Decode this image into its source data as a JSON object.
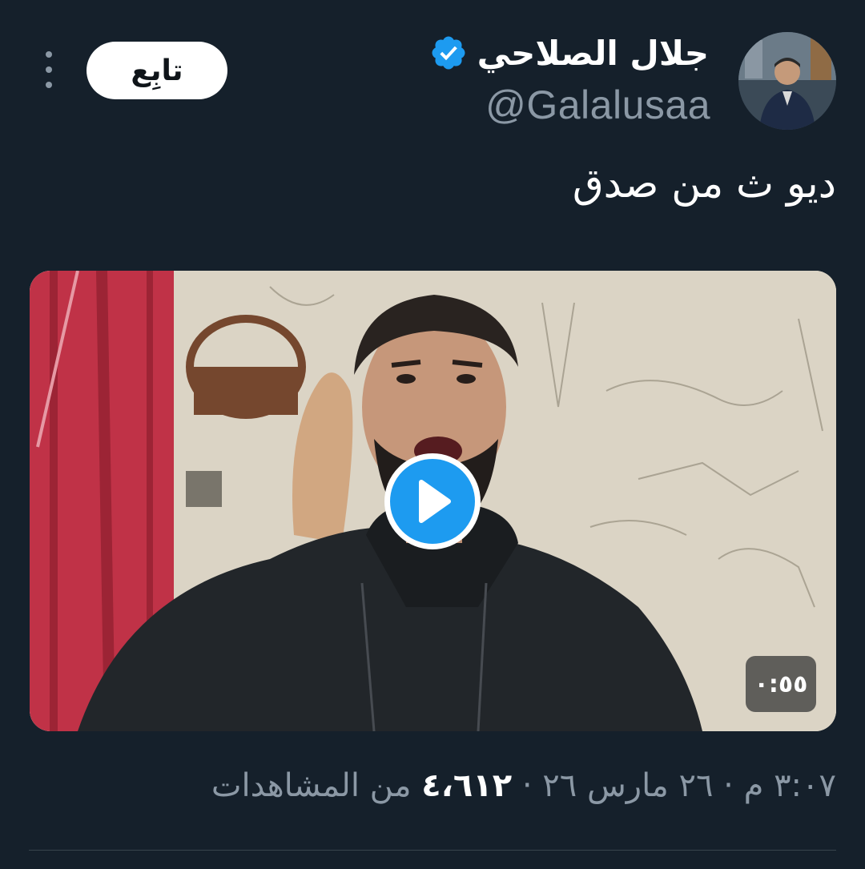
{
  "author": {
    "display_name": "جلال الصلاحي",
    "handle": "@Galalusaa",
    "verified": true
  },
  "follow_label": "تابِع",
  "tweet": {
    "text": "ديو ث من صدق"
  },
  "media": {
    "duration": "٠:٥٥"
  },
  "meta": {
    "time": "٣:٠٧ م",
    "date": "٢٦ مارس ٢٦",
    "views_count": "٤،٦١٢",
    "views_label": "من المشاهدات",
    "separator": "·"
  },
  "colors": {
    "background": "#15202b",
    "accent": "#1d9bf0",
    "secondary_text": "#8b98a5"
  },
  "icons": {
    "verified": "verified-badge-icon",
    "more": "more-vertical-icon",
    "play": "play-icon"
  }
}
